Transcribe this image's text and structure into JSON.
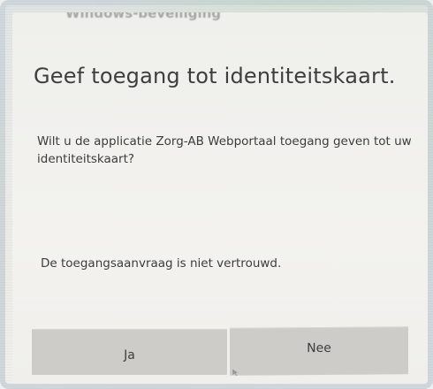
{
  "dialog": {
    "top_strip_text": "Windows-beveiliging",
    "title": "Geef toegang tot identiteitskaart.",
    "message": "Wilt u de applicatie Zorg-AB Webportaal toegang geven tot uw identiteitskaart?",
    "warning": "De toegangsaanvraag is niet vertrouwd.",
    "buttons": {
      "yes_label": "Ja",
      "no_label": "Nee"
    }
  },
  "colors": {
    "background": "#f1f0ed",
    "button": "#cdccc9",
    "text": "#3c3c3c"
  },
  "icons": {
    "cursor": "mouse-pointer-icon"
  }
}
